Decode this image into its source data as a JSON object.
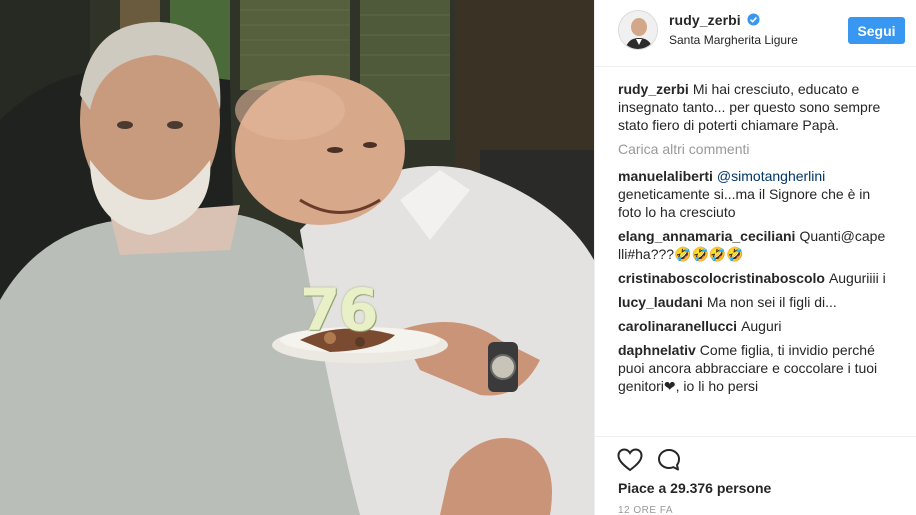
{
  "post": {
    "username": "rudy_zerbi",
    "location": "Santa Margherita Ligure",
    "follow_label": "Segui",
    "caption": "Mi hai cresciuto, educato e insegnato tanto... per questo sono sempre stato fiero di poterti chiamare Papà.",
    "candle_number": "76"
  },
  "comments": {
    "load_more": "Carica altri commenti",
    "items": [
      {
        "author": "manuelaliberti",
        "mention": "@simotangherlini",
        "text": " geneticamente si...ma il Signore che è in foto lo ha cresciuto"
      },
      {
        "author": "elang_annamaria_ceciliani",
        "mention": "",
        "text": "Quanti@capelli#ha???🤣🤣🤣🤣"
      },
      {
        "author": "cristinaboscolocristinaboscolo",
        "mention": "",
        "text": "Auguriiii i"
      },
      {
        "author": "lucy_laudani",
        "mention": "",
        "text": "Ma non sei il figli di..."
      },
      {
        "author": "carolinaranellucci",
        "mention": "",
        "text": "Auguri"
      },
      {
        "author": "daphnelativ",
        "mention": "",
        "text": "Come figlia, ti invidio perché puoi ancora abbracciare e coccolare i tuoi genitori❤, io li ho persi"
      }
    ]
  },
  "actions": {
    "likes": "Piace a 29.376 persone",
    "timestamp": "12 ORE FA"
  },
  "icons": {
    "like": "heart-outline-icon",
    "comment": "speech-bubble-icon",
    "verified": "verified-badge-icon"
  },
  "colors": {
    "follow_button": "#3897f0",
    "verified": "#3897f0",
    "mention": "#003569",
    "muted": "#999999"
  }
}
